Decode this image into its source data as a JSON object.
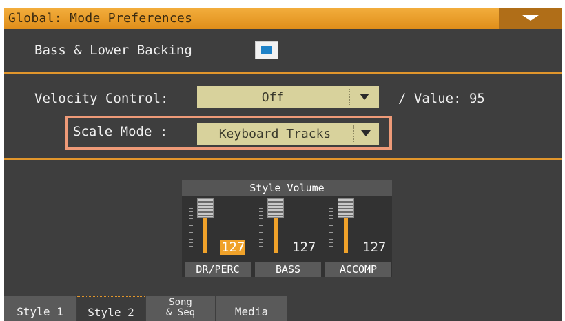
{
  "window": {
    "title": "Global: Mode Preferences"
  },
  "bass_lower": {
    "label": "Bass & Lower Backing",
    "checked": true
  },
  "velocity": {
    "label": "Velocity Control:",
    "value": "Off",
    "value_label": "/  Value: 95"
  },
  "scale_mode": {
    "label": "Scale Mode :",
    "value": "Keyboard Tracks"
  },
  "mixer": {
    "title": "Style Volume",
    "channels": [
      {
        "name": "DR/PERC",
        "value": "127",
        "selected": true
      },
      {
        "name": "BASS",
        "value": "127",
        "selected": false
      },
      {
        "name": "ACCOMP",
        "value": "127",
        "selected": false
      }
    ]
  },
  "tabs": {
    "style1": "Style 1",
    "style2": "Style 2",
    "song_seq_line1": "Song",
    "song_seq_line2": "& Seq",
    "media": "Media"
  },
  "colors": {
    "accent": "#e1962c",
    "panel": "#3e3e3e",
    "select": "#d8d29c",
    "highlight": "#ee9a78",
    "check": "#1e82c8"
  }
}
